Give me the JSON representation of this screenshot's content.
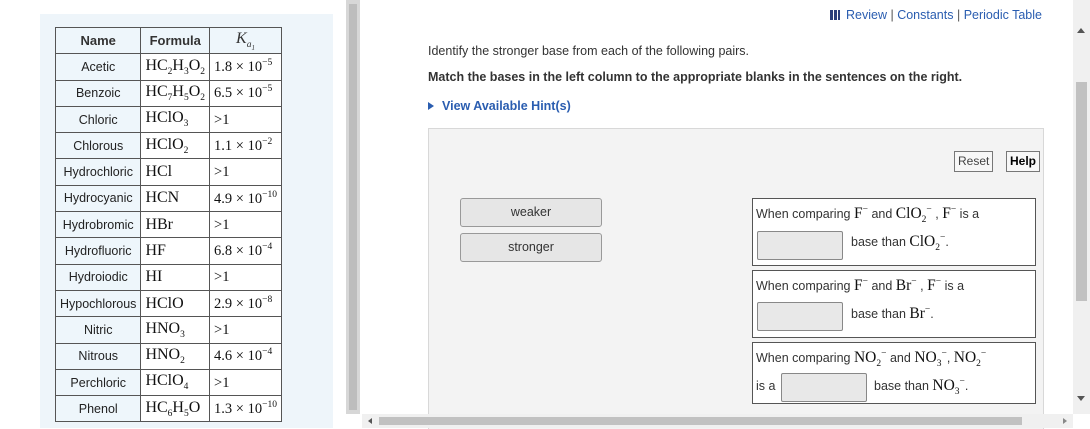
{
  "toplinks": {
    "review": "Review",
    "constants": "Constants",
    "periodic": "Periodic Table",
    "sep": "|"
  },
  "question": {
    "line1": "Identify the stronger base from each of the following pairs.",
    "line2": "Match the bases in the left column to the appropriate blanks in the sentences on the right.",
    "hint": "View Available Hint(s)"
  },
  "controls": {
    "reset": "Reset",
    "help": "Help"
  },
  "chips": [
    "weaker",
    "stronger"
  ],
  "table": {
    "headers": {
      "name": "Name",
      "formula": "Formula",
      "ka_symbol": "K",
      "ka_sub": "a",
      "ka_subsub": "1"
    },
    "rows": [
      {
        "name": "Acetic",
        "formula": [
          "HC",
          "2",
          "H",
          "3",
          "O",
          "2"
        ],
        "ka": [
          "1.8 × 10",
          "−5"
        ]
      },
      {
        "name": "Benzoic",
        "formula": [
          "HC",
          "7",
          "H",
          "5",
          "O",
          "2"
        ],
        "ka": [
          "6.5 × 10",
          "−5"
        ]
      },
      {
        "name": "Chloric",
        "formula": [
          "HClO",
          "3"
        ],
        "ka": [
          ">1",
          ""
        ]
      },
      {
        "name": "Chlorous",
        "formula": [
          "HClO",
          "2"
        ],
        "ka": [
          "1.1 × 10",
          "−2"
        ]
      },
      {
        "name": "Hydrochloric",
        "formula": [
          "HCl"
        ],
        "ka": [
          ">1",
          ""
        ]
      },
      {
        "name": "Hydrocyanic",
        "formula": [
          "HCN"
        ],
        "ka": [
          "4.9 × 10",
          "−10"
        ]
      },
      {
        "name": "Hydrobromic",
        "formula": [
          "HBr"
        ],
        "ka": [
          ">1",
          ""
        ]
      },
      {
        "name": "Hydrofluoric",
        "formula": [
          "HF"
        ],
        "ka": [
          "6.8 × 10",
          "−4"
        ]
      },
      {
        "name": "Hydroiodic",
        "formula": [
          "HI"
        ],
        "ka": [
          ">1",
          ""
        ]
      },
      {
        "name": "Hypochlorous",
        "formula": [
          "HClO"
        ],
        "ka": [
          "2.9 × 10",
          "−8"
        ]
      },
      {
        "name": "Nitric",
        "formula": [
          "HNO",
          "3"
        ],
        "ka": [
          ">1",
          ""
        ]
      },
      {
        "name": "Nitrous",
        "formula": [
          "HNO",
          "2"
        ],
        "ka": [
          "4.6 × 10",
          "−4"
        ]
      },
      {
        "name": "Perchloric",
        "formula": [
          "HClO",
          "4"
        ],
        "ka": [
          ">1",
          ""
        ]
      },
      {
        "name": "Phenol",
        "formula": [
          "HC",
          "6",
          "H",
          "5",
          "O"
        ],
        "ka": [
          "1.3 × 10",
          "−10"
        ]
      }
    ]
  },
  "sentences": [
    {
      "a": "When comparing",
      "f1": "F",
      "f1sup": "−",
      "and": "and",
      "f2": "ClO",
      "f2sub": "2",
      "f2sup": "−",
      "comma": ",",
      "f3": "F",
      "f3sup": "−",
      "isa": "is a",
      "base": "base than",
      "f4": "ClO",
      "f4sub": "2",
      "f4sup": "−",
      "end": "."
    },
    {
      "a": "When comparing",
      "f1": "F",
      "f1sup": "−",
      "and": "and",
      "f2": "Br",
      "f2sup": "−",
      "comma": ",",
      "f3": "F",
      "f3sup": "−",
      "isa": "is a",
      "base": "base than",
      "f4": "Br",
      "f4sup": "−",
      "end": "."
    },
    {
      "a": "When comparing",
      "f1": "NO",
      "f1sub": "2",
      "f1sup": "−",
      "and": "and",
      "f2": "NO",
      "f2sub": "3",
      "f2sup": "−",
      "comma": ",",
      "f3": "NO",
      "f3sub": "2",
      "f3sup": "−",
      "isa": "is a",
      "base": "base than",
      "f4": "NO",
      "f4sub": "3",
      "f4sup": "−",
      "end": "."
    }
  ]
}
